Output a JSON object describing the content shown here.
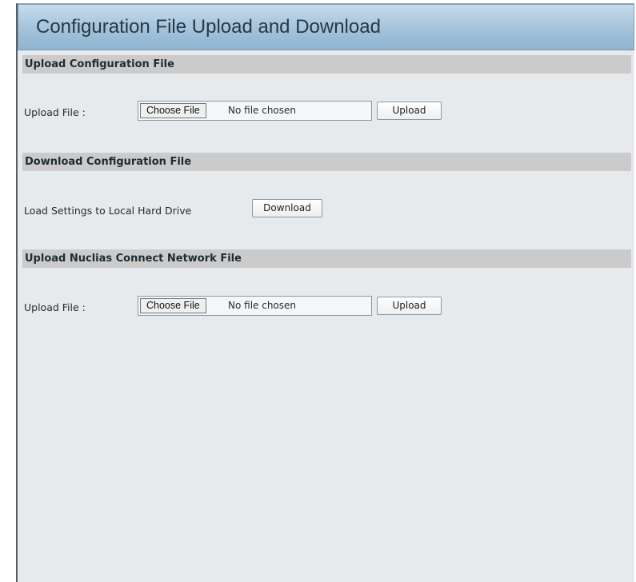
{
  "page": {
    "title": "Configuration File Upload and Download"
  },
  "upload_config": {
    "header": "Upload Configuration File",
    "label": "Upload File :",
    "choose_label": "Choose File",
    "file_status": "No file chosen",
    "upload_label": "Upload"
  },
  "download_config": {
    "header": "Download Configuration File",
    "label": "Load Settings to Local Hard Drive",
    "download_label": "Download"
  },
  "upload_nuclias": {
    "header": "Upload Nuclias Connect Network File",
    "label": "Upload File :",
    "choose_label": "Choose File",
    "file_status": "No file chosen",
    "upload_label": "Upload"
  },
  "colors": {
    "title_bar_gradient_top": "#c8dbea",
    "title_bar_gradient_bottom": "#8fb3d0",
    "section_header_bg": "#cbcbcb",
    "panel_bg": "#e6eaec"
  }
}
